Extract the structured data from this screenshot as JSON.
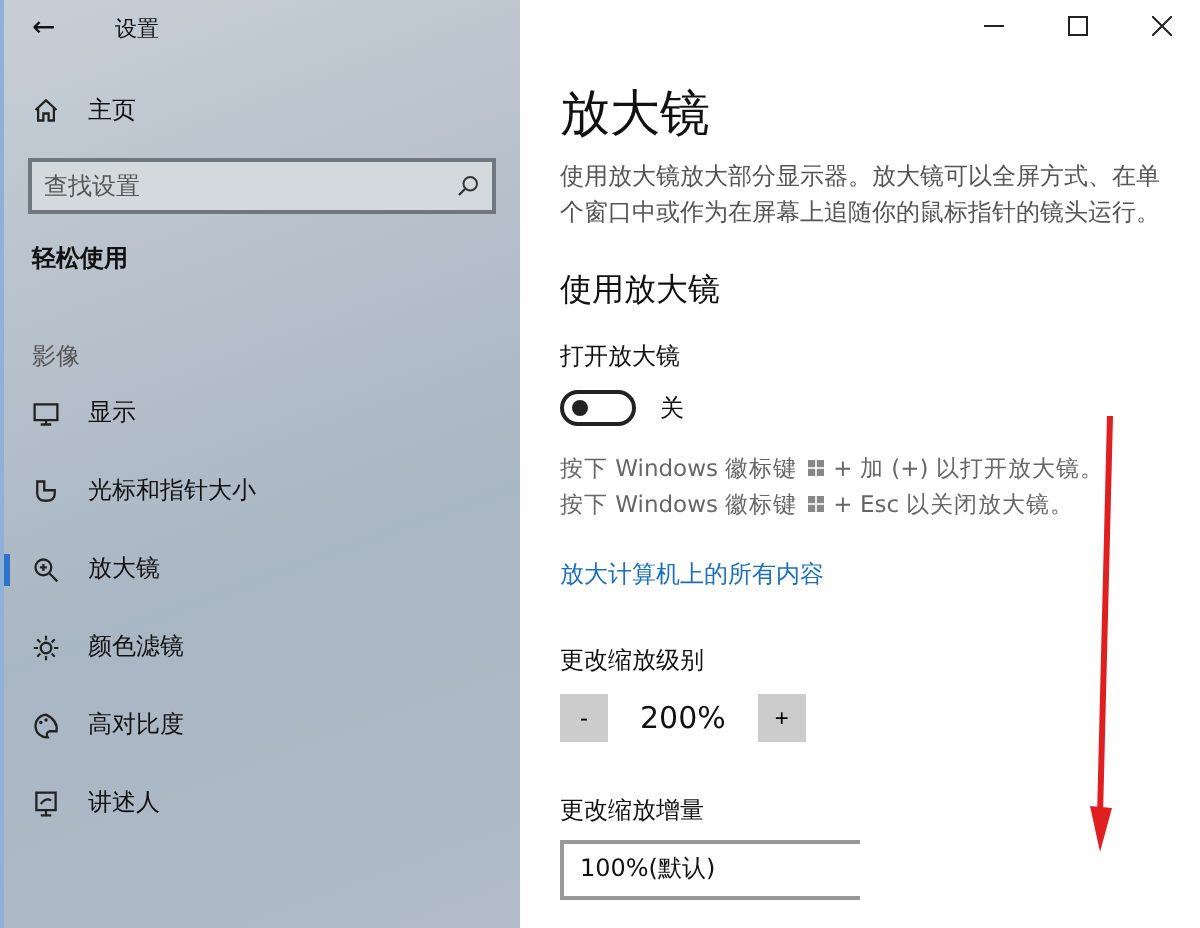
{
  "window": {
    "title": "设置",
    "back": "←"
  },
  "sidebar": {
    "home": "主页",
    "search": {
      "placeholder": "查找设置"
    },
    "category": "轻松使用",
    "section": "影像",
    "items": [
      {
        "label": "显示",
        "selected": false
      },
      {
        "label": "光标和指针大小",
        "selected": false
      },
      {
        "label": "放大镜",
        "selected": true
      },
      {
        "label": "颜色滤镜",
        "selected": false
      },
      {
        "label": "高对比度",
        "selected": false
      },
      {
        "label": "讲述人",
        "selected": false
      }
    ]
  },
  "page": {
    "title": "放大镜",
    "description": "使用放大镜放大部分显示器。放大镜可以全屏方式、在单个窗口中或作为在屏幕上追随你的鼠标指针的镜头运行。",
    "section": "使用放大镜",
    "toggle": {
      "label": "打开放大镜",
      "on": false,
      "state_text": "关"
    },
    "hotkeys": [
      {
        "before": "按下 Windows 徽标键",
        "after": "+ 加 (+) 以打开放大镜。"
      },
      {
        "before": "按下 Windows 徽标键",
        "after": "+ Esc 以关闭放大镜。"
      }
    ],
    "link": "放大计算机上的所有内容",
    "zoom_level": {
      "label": "更改缩放级别",
      "minus": "-",
      "value": "200%",
      "plus": "+"
    },
    "zoom_increment": {
      "label": "更改缩放增量",
      "value": "100%(默认)"
    }
  }
}
